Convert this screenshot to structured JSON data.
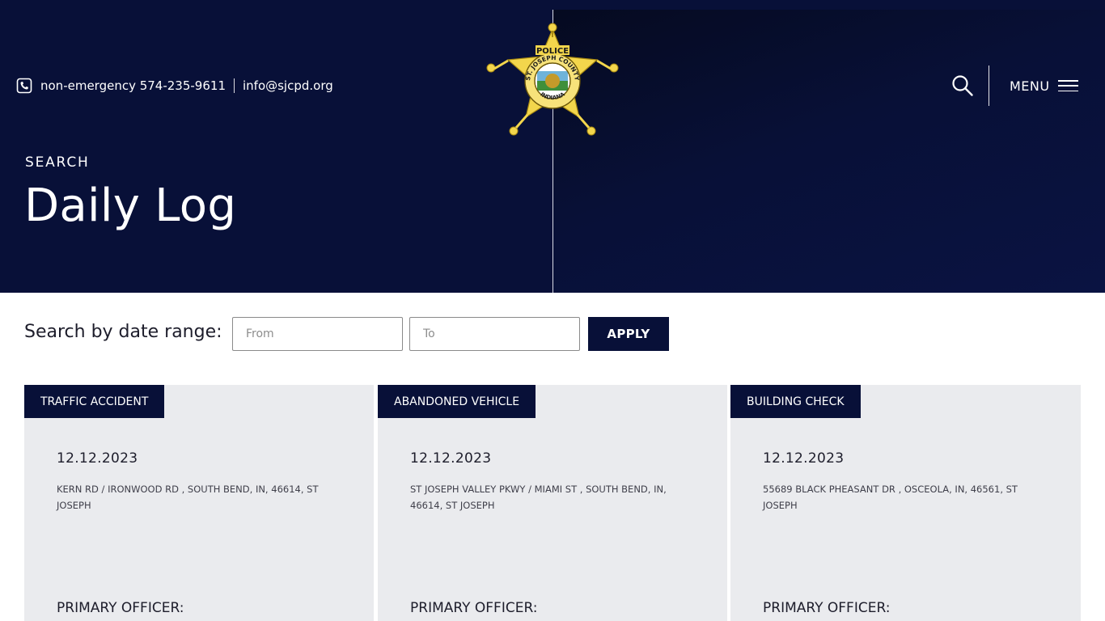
{
  "header": {
    "contact": {
      "phone": "non-emergency 574-235-9611",
      "email": "info@sjcpd.org"
    },
    "logo": {
      "top_text": "POLICE",
      "ring_text": "ST. JOSEPH COUNTY",
      "bottom_text": "INDIANA",
      "color": "#f3d64c"
    },
    "menu_label": "MENU",
    "eyebrow": "SEARCH",
    "title": "Daily Log"
  },
  "search": {
    "label": "Search by date range:",
    "from_placeholder": "From",
    "to_placeholder": "To",
    "apply_label": "APPLY"
  },
  "cards": [
    {
      "tag": "TRAFFIC ACCIDENT",
      "date": "12.12.2023",
      "address": "KERN RD / IRONWOOD RD , SOUTH BEND, IN, 46614, ST JOSEPH",
      "officer_label": "PRIMARY OFFICER:"
    },
    {
      "tag": "ABANDONED VEHICLE",
      "date": "12.12.2023",
      "address": "ST JOSEPH VALLEY PKWY / MIAMI ST , SOUTH BEND, IN, 46614, ST JOSEPH",
      "officer_label": "PRIMARY OFFICER:"
    },
    {
      "tag": "BUILDING CHECK",
      "date": "12.12.2023",
      "address": "55689 BLACK PHEASANT DR , OSCEOLA, IN, 46561, ST JOSEPH",
      "officer_label": "PRIMARY OFFICER:"
    }
  ],
  "colors": {
    "navy": "#081038",
    "card_bg": "#eaebee",
    "badge_gold": "#f3d64c"
  },
  "icons": {
    "phone": "phone-icon",
    "search": "search-icon",
    "menu": "hamburger-menu-icon",
    "logo": "sheriff-star-badge-icon"
  }
}
